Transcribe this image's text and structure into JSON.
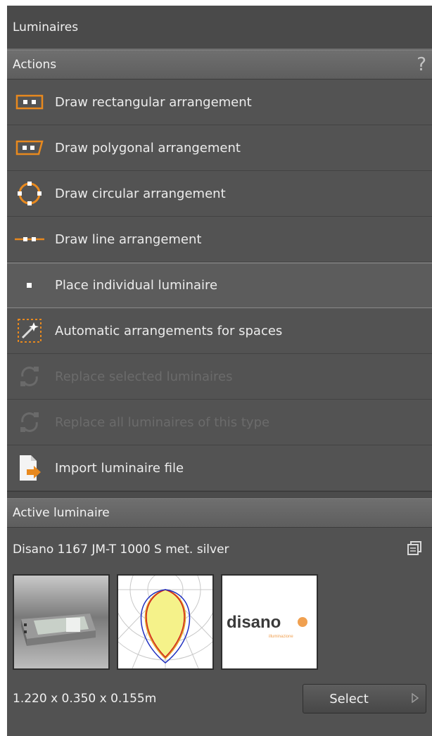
{
  "panel": {
    "title": "Luminaires",
    "actions_header": "Actions",
    "help_symbol": "?"
  },
  "actions": [
    {
      "label": "Draw rectangular arrangement",
      "icon": "rectangular-arrangement-icon",
      "state": "normal"
    },
    {
      "label": "Draw polygonal arrangement",
      "icon": "polygonal-arrangement-icon",
      "state": "normal"
    },
    {
      "label": "Draw circular arrangement",
      "icon": "circular-arrangement-icon",
      "state": "normal"
    },
    {
      "label": "Draw line arrangement",
      "icon": "line-arrangement-icon",
      "state": "normal"
    },
    {
      "label": "Place individual luminaire",
      "icon": "individual-luminaire-icon",
      "state": "selected"
    },
    {
      "label": "Automatic arrangements for spaces",
      "icon": "magic-wand-icon",
      "state": "normal"
    },
    {
      "label": "Replace selected luminaires",
      "icon": "replace-icon",
      "state": "disabled"
    },
    {
      "label": "Replace all luminaires of this type",
      "icon": "replace-all-icon",
      "state": "disabled"
    },
    {
      "label": "Import luminaire file",
      "icon": "import-file-icon",
      "state": "normal"
    }
  ],
  "active": {
    "header": "Active luminaire",
    "name": "Disano 1167 JM-T 1000 S  met. silver",
    "dimensions": "1.220 x 0.350 x 0.155m",
    "select_label": "Select",
    "logo_text": "disano",
    "logo_subtext": "illuminazione"
  },
  "colors": {
    "accent": "#e8891e",
    "panel_bg": "#525252",
    "disabled_text": "#6b6b6b"
  }
}
